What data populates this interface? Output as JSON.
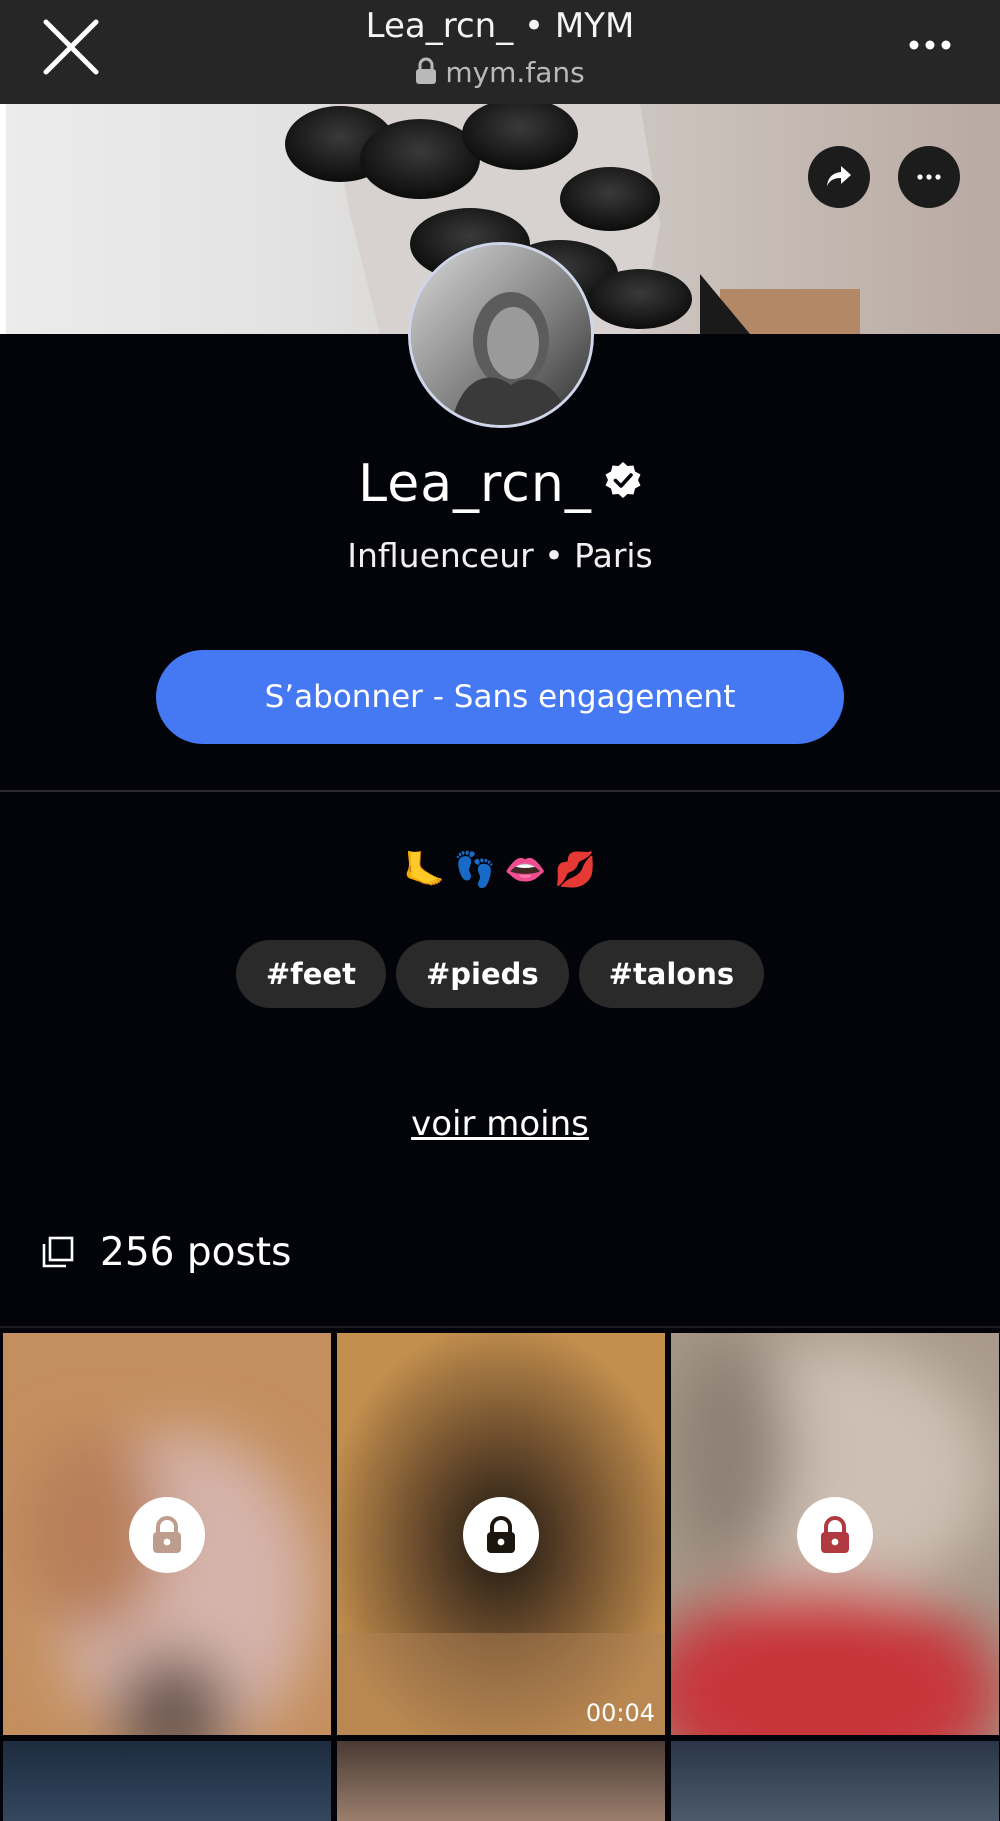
{
  "header": {
    "title": "Lea_rcn_ • MYM",
    "url": "mym.fans"
  },
  "profile": {
    "name": "Lea_rcn_",
    "subtitle": "Influenceur • Paris",
    "subscribe_label": "S’abonner - Sans engagement",
    "emojis": [
      "🦶",
      "👣",
      "👄",
      "💋"
    ],
    "tags": [
      "#feet",
      "#pieds",
      "#talons"
    ],
    "see_less": "voir moins",
    "posts_count": "256 posts"
  },
  "posts": [
    {
      "locked": true,
      "duration": ""
    },
    {
      "locked": true,
      "duration": "00:04"
    },
    {
      "locked": true,
      "duration": ""
    }
  ],
  "colors": {
    "accent": "#4578f3",
    "background": "#03040a",
    "topbar": "#262626"
  }
}
